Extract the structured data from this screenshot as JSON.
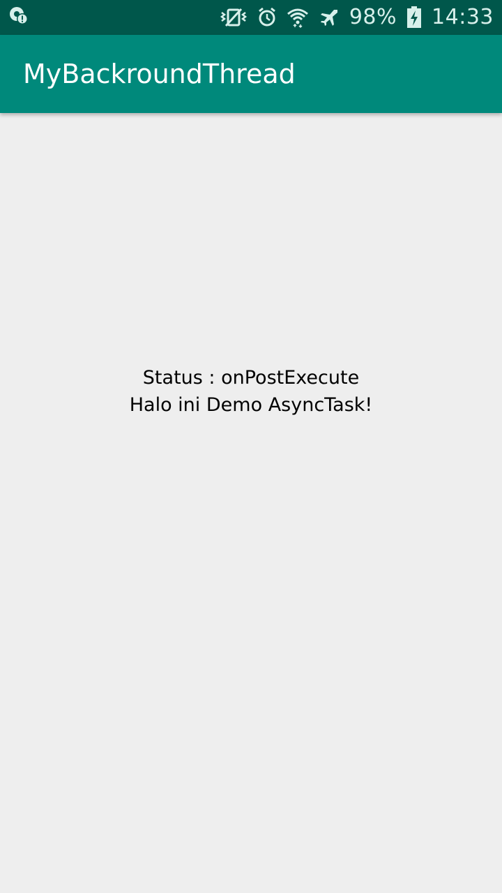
{
  "status_bar": {
    "battery": "98%",
    "time": "14:33",
    "icons": {
      "left": "notification-alert-icon",
      "right": [
        "vibrate-mute-icon",
        "alarm-icon",
        "wifi-icon",
        "airplane-mode-icon",
        "battery-charging-icon"
      ]
    }
  },
  "app_bar": {
    "title": "MyBackroundThread"
  },
  "content": {
    "status_line": "Status : onPostExecute",
    "message_line": "Halo ini Demo AsyncTask!"
  },
  "colors": {
    "status_bar": "#00574b",
    "app_bar": "#00897b",
    "background": "#eeeeee"
  }
}
